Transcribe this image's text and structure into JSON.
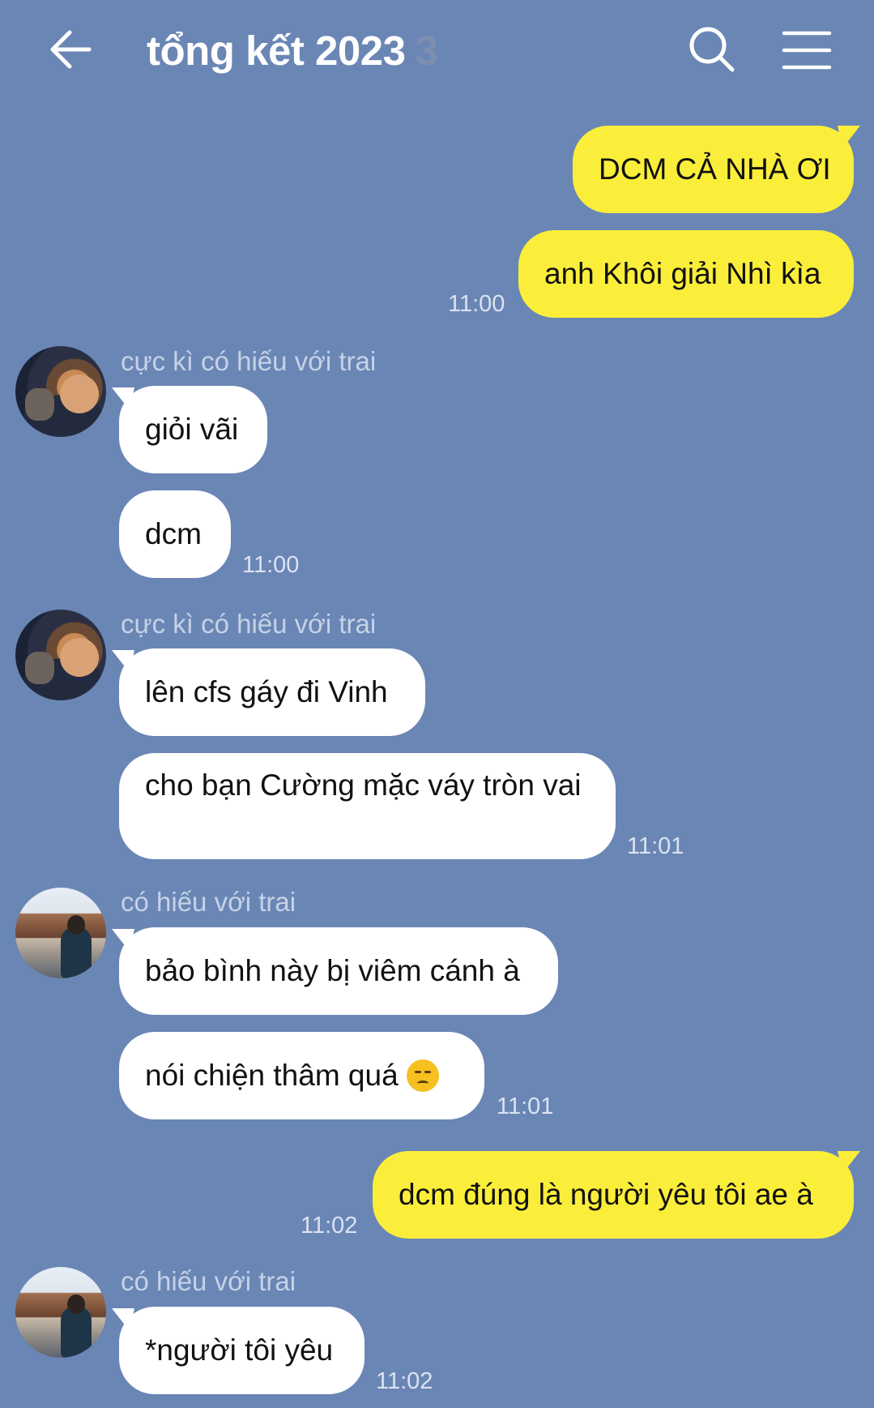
{
  "header": {
    "title": "tổng kết 2023",
    "member_count": "3",
    "back_icon": "arrow-left-icon",
    "search_icon": "search-icon",
    "menu_icon": "hamburger-menu-icon"
  },
  "colors": {
    "background": "#6a86b5",
    "outgoing_bubble": "#fbee3a",
    "incoming_bubble": "#ffffff"
  },
  "messages": [
    {
      "direction": "out",
      "text": "DCM CẢ NHÀ ƠI"
    },
    {
      "direction": "out",
      "text": "anh Khôi giải Nhì kìa",
      "time": "11:00"
    },
    {
      "direction": "in",
      "sender": "cực kì có hiếu với trai",
      "text": "giỏi vãi"
    },
    {
      "direction": "in",
      "text": "dcm",
      "time": "11:00"
    },
    {
      "direction": "in",
      "sender": "cực kì có hiếu với trai",
      "text": "lên cfs gáy đi Vinh"
    },
    {
      "direction": "in",
      "text": "cho bạn Cường mặc váy tròn vai",
      "time": "11:01"
    },
    {
      "direction": "in",
      "sender": "có hiếu với trai",
      "text": "bảo bình này bị viêm cánh à"
    },
    {
      "direction": "in",
      "text": "nói chiện thâm quá",
      "emoji": "disappointed-face-emoji",
      "time": "11:01"
    },
    {
      "direction": "out",
      "text": "dcm đúng là người yêu tôi ae à",
      "time": "11:02"
    },
    {
      "direction": "in",
      "sender": "có hiếu với trai",
      "text": "*người tôi yêu",
      "time": "11:02"
    }
  ]
}
